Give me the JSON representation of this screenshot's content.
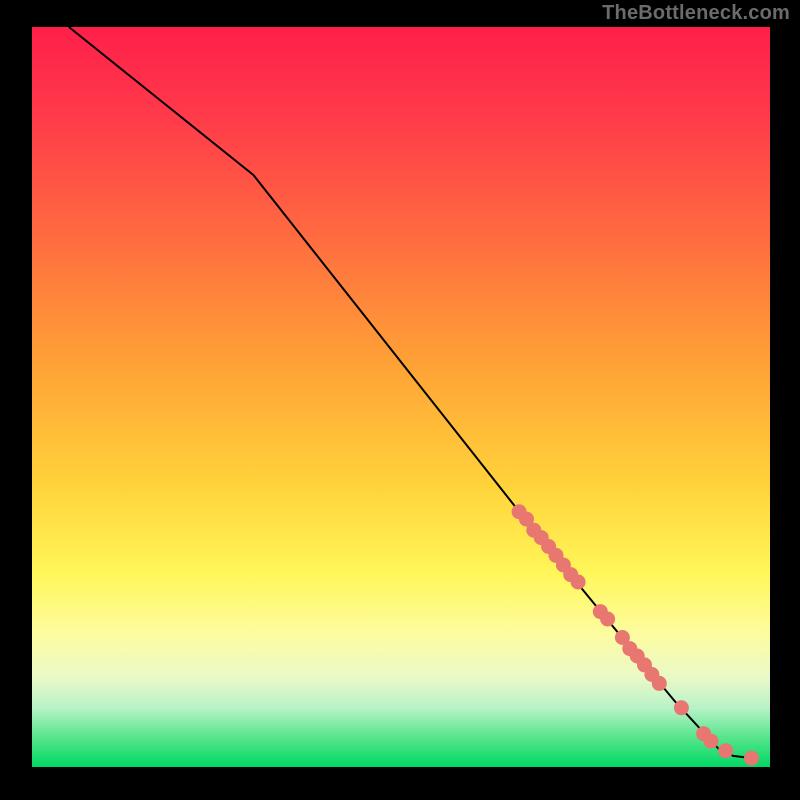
{
  "attribution": "TheBottleneck.com",
  "chart_data": {
    "type": "line",
    "title": "",
    "xlabel": "",
    "ylabel": "",
    "xlim": [
      0,
      100
    ],
    "ylim": [
      0,
      100
    ],
    "background": "rainbow-gradient-vertical",
    "series": [
      {
        "name": "curve",
        "type": "line",
        "x": [
          5,
          30,
          68,
          82,
          87,
          93,
          95,
          97.5
        ],
        "y": [
          100,
          80,
          32,
          15,
          9,
          2.5,
          1.5,
          1.2
        ]
      },
      {
        "name": "points",
        "type": "scatter",
        "x": [
          66,
          67,
          68,
          69,
          70,
          71,
          72,
          73,
          74,
          77,
          78,
          80,
          81,
          82,
          83,
          84,
          85,
          88,
          91,
          92,
          94,
          97.5
        ],
        "y": [
          34.5,
          33.5,
          32,
          31,
          29.8,
          28.6,
          27.3,
          26,
          25,
          21,
          20,
          17.5,
          16,
          15,
          13.8,
          12.5,
          11.3,
          8,
          4.5,
          3.5,
          2.2,
          1.2
        ],
        "marker_size": 7
      }
    ]
  }
}
